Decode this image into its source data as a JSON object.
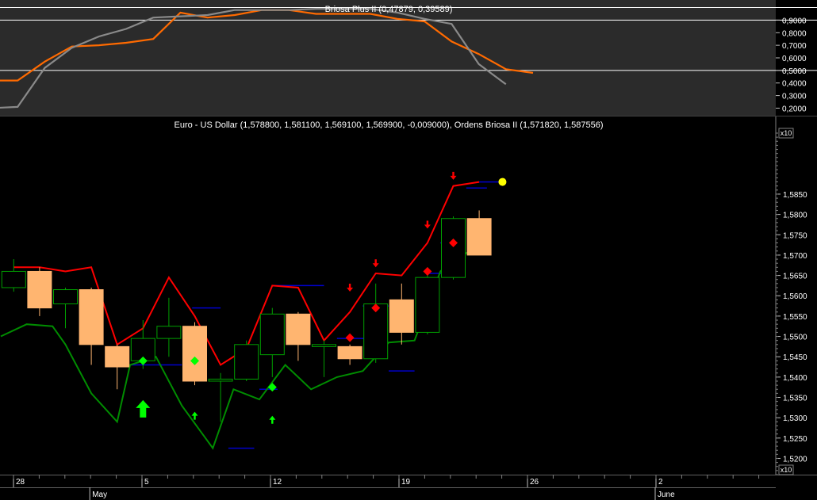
{
  "top_panel": {
    "title": "Briosa Plus II (0,47879, 0,39589)",
    "unit_badge": "",
    "chart_data": {
      "type": "line",
      "ylim": [
        0.14,
        1.06
      ],
      "grid": false,
      "reference_lines": [
        1.0,
        0.9,
        0.5
      ],
      "y_ticks": [
        "0,9000",
        "0,8000",
        "0,7000",
        "0,6000",
        "0,5000",
        "0,4000",
        "0,3000",
        "0,2000"
      ],
      "y_tick_values": [
        0.9,
        0.8,
        0.7,
        0.6,
        0.5,
        0.4,
        0.3,
        0.2
      ],
      "series": [
        {
          "color": "#ff6a00",
          "values": [
            0.42,
            0.42,
            0.57,
            0.69,
            0.7,
            0.72,
            0.75,
            0.96,
            0.92,
            0.94,
            0.98,
            0.98,
            0.95,
            0.95,
            0.95,
            0.91,
            0.89,
            0.73,
            0.63,
            0.51,
            0.48,
            null
          ]
        },
        {
          "color": "#8a8a8a",
          "values": [
            0.2,
            0.21,
            0.52,
            0.68,
            0.77,
            0.83,
            0.92,
            0.93,
            0.94,
            0.98,
            0.98,
            0.98,
            0.99,
            0.99,
            0.99,
            0.96,
            0.91,
            0.87,
            0.55,
            0.39,
            null,
            null
          ]
        }
      ]
    }
  },
  "main_panel": {
    "title": "Euro - US Dollar (1,578800, 1,581100, 1,569100, 1,569900, -0,009000), Ordens Briosa II (1,571820, 1,587556)",
    "unit_badge": "x10",
    "chart_data": {
      "type": "candlestick",
      "ylim": [
        1.516,
        1.6
      ],
      "grid": false,
      "y_ticks": [
        "1,5850",
        "1,5800",
        "1,5750",
        "1,5700",
        "1,5650",
        "1,5600",
        "1,5550",
        "1,5500",
        "1,5450",
        "1,5400",
        "1,5350",
        "1,5300",
        "1,5250",
        "1,5200"
      ],
      "y_tick_values": [
        1.585,
        1.58,
        1.575,
        1.57,
        1.565,
        1.56,
        1.555,
        1.55,
        1.545,
        1.54,
        1.535,
        1.53,
        1.525,
        1.52
      ],
      "candles": [
        {
          "o": 1.562,
          "h": 1.569,
          "l": 1.561,
          "c": 1.566
        },
        {
          "o": 1.566,
          "h": 1.567,
          "l": 1.555,
          "c": 1.557
        },
        {
          "o": 1.558,
          "h": 1.562,
          "l": 1.552,
          "c": 1.5615
        },
        {
          "o": 1.5615,
          "h": 1.562,
          "l": 1.543,
          "c": 1.548
        },
        {
          "o": 1.5475,
          "h": 1.548,
          "l": 1.537,
          "c": 1.5425
        },
        {
          "o": 1.544,
          "h": 1.554,
          "l": 1.542,
          "c": 1.5495
        },
        {
          "o": 1.5495,
          "h": 1.5595,
          "l": 1.545,
          "c": 1.5525
        },
        {
          "o": 1.5525,
          "h": 1.5535,
          "l": 1.538,
          "c": 1.539
        },
        {
          "o": 1.539,
          "h": 1.541,
          "l": 1.529,
          "c": 1.5395
        },
        {
          "o": 1.5395,
          "h": 1.549,
          "l": 1.539,
          "c": 1.548
        },
        {
          "o": 1.5455,
          "h": 1.557,
          "l": 1.54,
          "c": 1.5555
        },
        {
          "o": 1.5555,
          "h": 1.556,
          "l": 1.544,
          "c": 1.548
        },
        {
          "o": 1.5475,
          "h": 1.549,
          "l": 1.54,
          "c": 1.548
        },
        {
          "o": 1.5475,
          "h": 1.548,
          "l": 1.543,
          "c": 1.5445
        },
        {
          "o": 1.5445,
          "h": 1.563,
          "l": 1.5435,
          "c": 1.558
        },
        {
          "o": 1.559,
          "h": 1.563,
          "l": 1.548,
          "c": 1.551
        },
        {
          "o": 1.551,
          "h": 1.567,
          "l": 1.5505,
          "c": 1.5645
        },
        {
          "o": 1.5645,
          "h": 1.5795,
          "l": 1.564,
          "c": 1.579
        },
        {
          "o": 1.579,
          "h": 1.581,
          "l": 1.57,
          "c": 1.57
        }
      ],
      "upper_band": [
        1.567,
        1.567,
        1.566,
        1.567,
        1.548,
        1.552,
        1.5645,
        1.555,
        1.543,
        1.547,
        1.5625,
        1.562,
        1.549,
        1.556,
        1.5655,
        1.565,
        1.573,
        1.587,
        1.588
      ],
      "lower_band": [
        1.55,
        1.553,
        1.5525,
        1.548,
        1.536,
        1.529,
        1.543,
        1.545,
        1.533,
        1.5225,
        1.537,
        1.5345,
        1.543,
        1.537,
        1.54,
        1.5415,
        1.5485,
        1.549,
        1.566,
        1.572
      ],
      "band_x": [
        0.5,
        1.5,
        2.5,
        3.5,
        4.5,
        5.5,
        6.5,
        7.5,
        8.5,
        9.5,
        10.5,
        11.5,
        12.5,
        13.5,
        14.5,
        15.5,
        16.5,
        17.5,
        18.5
      ],
      "lower_x": [
        0,
        1,
        2,
        2.5,
        3.5,
        4.5,
        5,
        6,
        7,
        8.2,
        9,
        10,
        11,
        12,
        13,
        14,
        15,
        16,
        17,
        17.5,
        18.5
      ],
      "lower_values": [
        1.55,
        1.553,
        1.5525,
        1.548,
        1.536,
        1.529,
        1.543,
        1.545,
        1.533,
        1.5225,
        1.537,
        1.5345,
        1.543,
        1.537,
        1.54,
        1.5415,
        1.5485,
        1.549,
        1.566,
        1.569,
        1.572
      ],
      "blue_levels": [
        {
          "x0": 7.4,
          "x1": 8.5,
          "y": 1.557
        },
        {
          "x0": 10.5,
          "x1": 12.5,
          "y": 1.5625
        },
        {
          "x0": 13.0,
          "x1": 14.5,
          "y": 1.5495
        },
        {
          "x0": 14.0,
          "x1": 15.0,
          "y": 1.5575
        },
        {
          "x0": 15.0,
          "x1": 16.0,
          "y": 1.5415
        },
        {
          "x0": 16.5,
          "x1": 17.5,
          "y": 1.5655
        },
        {
          "x0": 17.0,
          "x1": 17.6,
          "y": 1.573
        },
        {
          "x0": 18.0,
          "x1": 18.8,
          "y": 1.5865
        },
        {
          "x0": 18.5,
          "x1": 19.4,
          "y": 1.588
        },
        {
          "x0": 6.0,
          "x1": 7.0,
          "y": 1.543
        },
        {
          "x0": 8.8,
          "x1": 9.8,
          "y": 1.5225
        },
        {
          "x0": 10.0,
          "x1": 10.7,
          "y": 1.537
        },
        {
          "x0": 5.0,
          "x1": 6.0,
          "y": 1.543
        }
      ],
      "green_diamonds": [
        {
          "x": 5.5,
          "y": 1.544
        },
        {
          "x": 7.5,
          "y": 1.544
        },
        {
          "x": 10.5,
          "y": 1.5375
        }
      ],
      "red_diamonds": [
        {
          "x": 13.5,
          "y": 1.5497
        },
        {
          "x": 14.5,
          "y": 1.557
        },
        {
          "x": 16.5,
          "y": 1.566
        },
        {
          "x": 17.5,
          "y": 1.573
        }
      ],
      "green_arrows": [
        {
          "x": 5.5,
          "y": 1.532,
          "size": "large"
        },
        {
          "x": 7.5,
          "y": 1.5305,
          "size": "small"
        },
        {
          "x": 10.5,
          "y": 1.5295,
          "size": "small"
        }
      ],
      "red_arrows": [
        {
          "x": 13.5,
          "y": 1.562
        },
        {
          "x": 14.5,
          "y": 1.568
        },
        {
          "x": 16.5,
          "y": 1.5775
        },
        {
          "x": 17.5,
          "y": 1.5895
        }
      ],
      "last_marker": {
        "x": 19.4,
        "y": 1.588,
        "color": "#ffff00"
      }
    }
  },
  "x_axis": {
    "unit_badge": "x10",
    "day_labels": [
      {
        "label": "28",
        "x": 0
      },
      {
        "label": "5",
        "x": 5
      },
      {
        "label": "12",
        "x": 10
      },
      {
        "label": "19",
        "x": 15
      },
      {
        "label": "26",
        "x": 20
      },
      {
        "label": "2",
        "x": 25
      }
    ],
    "month_labels": [
      {
        "label": "May",
        "x": 3
      },
      {
        "label": "June",
        "x": 25
      }
    ]
  },
  "colors": {
    "top_bg": "#2b2b2b",
    "main_bg": "#000000",
    "bull_candle": "#00a000",
    "bear_candle": "#ffb570",
    "upper_band": "#ff0000",
    "lower_band": "#008c00",
    "levels": "#0000cc",
    "axis_text": "#ffffff"
  }
}
